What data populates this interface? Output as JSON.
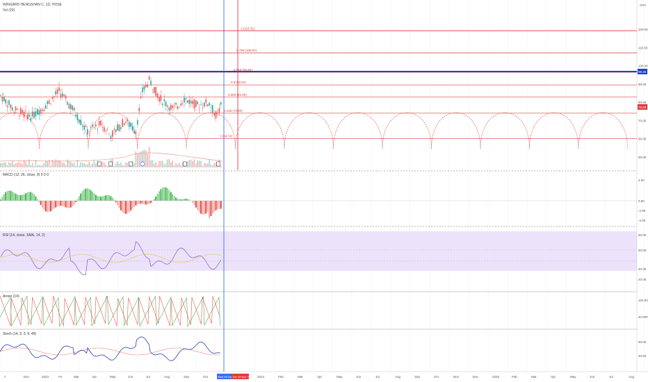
{
  "header": {
    "symbol_line": "WINGARD HENGSHAN C, 1D, HOSE",
    "vol_label": "Vol (20)"
  },
  "price_axis": {
    "currency": "CNY",
    "ticks": [
      "120.00",
      "110.00",
      "100.00",
      "90.00",
      "80.00",
      "70.00",
      "60.00",
      "50.00"
    ],
    "last_blue": "96.45",
    "last_red": "76.40"
  },
  "fib_labels": [
    {
      "text": "1 (119.32)",
      "price": 119
    },
    {
      "text": "0.786 (106.97)",
      "price": 107
    },
    {
      "text": "0.618 (96.25)",
      "price": 96.4
    },
    {
      "text": "0.5 (89.52)",
      "price": 89.5
    },
    {
      "text": "0.382 (82.80)",
      "price": 82.8
    },
    {
      "text": "0.236 (73.80)",
      "price": 74
    },
    {
      "text": "0 (59.74)",
      "price": 60
    }
  ],
  "indicators": {
    "macd_label": "MACD (12, 26, close, 9) 0 0 0",
    "rsi_label": "RSI (14, close, SMA, 14, 2)",
    "aroon_label": "Aroon (14)",
    "stoch_label": "Stoch (14, 3, 3, 9, 49)"
  },
  "macd_axis": [
    "0.00",
    "-2.00",
    "-4.00"
  ],
  "macd_axis_top": "4.00",
  "rsi_axis": [
    "80.00",
    "60.00",
    "40.00",
    "20.00"
  ],
  "aroon_axis": [
    "100.00%",
    "40.00%"
  ],
  "stoch_axis": [
    "80.00",
    "40.00"
  ],
  "x_axis": {
    "labels": [
      "7",
      "Dec",
      "2023",
      "Fe",
      "Mar",
      "Apr",
      "May",
      "Jun",
      "Jul",
      "Aug",
      "Sep",
      "Oct",
      "Nov",
      "2024",
      "Feb",
      "Mar",
      "Apr",
      "May",
      "Jun",
      "Jul",
      "Aug",
      "Sep",
      "Oct",
      "Nov",
      "Dec",
      "2025",
      "Feb",
      "Mar",
      "Apr",
      "May",
      "Jun",
      "Jul",
      "Aug"
    ],
    "highlight_blue": "Wed 08 Nov",
    "highlight_red": "Tue 10 Nov '23"
  },
  "events": [
    "D",
    "D",
    "D",
    "E",
    "D"
  ],
  "colors": {
    "up": "#26a69a",
    "down": "#ef5350",
    "fib": "#e23b3b",
    "blue_line": "#1f3fd1",
    "cursor": "#3a6df0",
    "rsi_fill": "#ece3fb",
    "stoch_k": "#2a3bb7",
    "stoch_d": "#e98a7a"
  }
}
